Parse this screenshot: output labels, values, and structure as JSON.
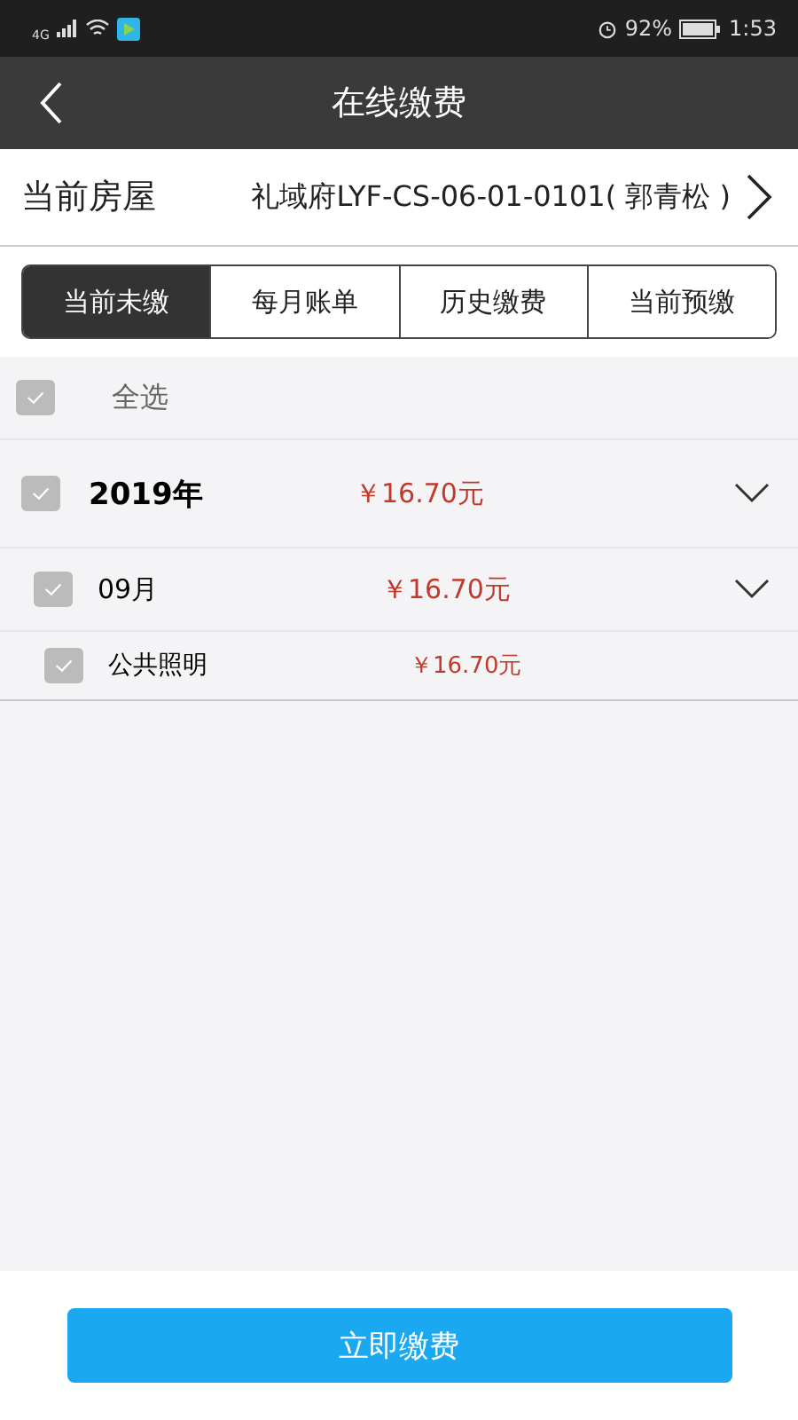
{
  "status_bar": {
    "battery_text": "92%",
    "time": "1:53",
    "signal_label": "4G"
  },
  "nav_bar": {
    "title": "在线缴费"
  },
  "house": {
    "label": "当前房屋",
    "value": "礼域府LYF-CS-06-01-0101( 郭青松 )"
  },
  "tabs": [
    {
      "label": "当前未缴",
      "selected": true
    },
    {
      "label": "每月账单",
      "selected": false
    },
    {
      "label": "历史缴费",
      "selected": false
    },
    {
      "label": "当前预缴",
      "selected": false
    }
  ],
  "select_all": {
    "label": "全选",
    "checked": false
  },
  "bills": [
    {
      "label": "2019年",
      "amount": "￥16.70元",
      "checked": false,
      "expanded": true,
      "children": [
        {
          "label": "09月",
          "amount": "￥16.70元",
          "checked": false,
          "expanded": true,
          "children": [
            {
              "label": "公共照明",
              "amount": "￥16.70元",
              "checked": false
            }
          ]
        }
      ]
    }
  ],
  "pay_button": {
    "label": "立即缴费"
  }
}
